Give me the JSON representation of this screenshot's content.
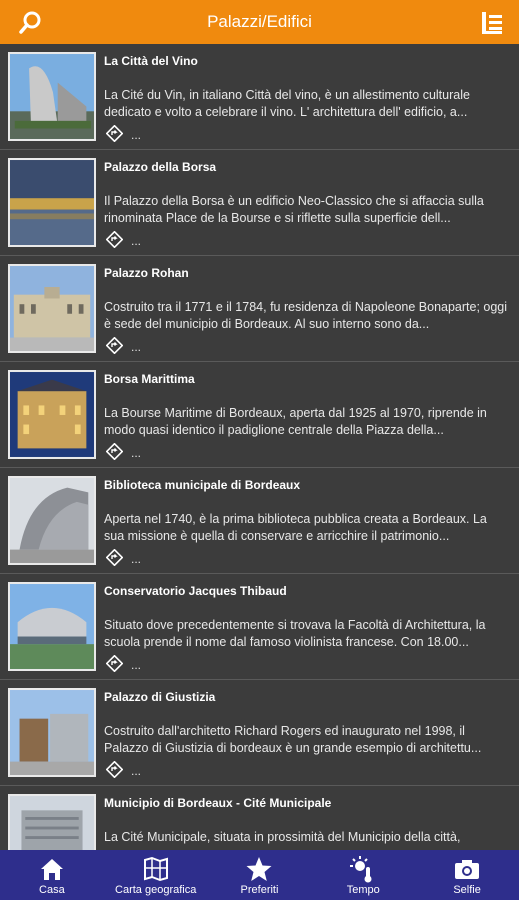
{
  "header": {
    "title": "Palazzi/Edifici",
    "search_icon": "search-icon",
    "menu_icon": "list-menu-icon"
  },
  "items": [
    {
      "title": "La Città del Vino",
      "desc": "La Cité du Vin, in italiano Città del vino, è un allestimento culturale dedicato e volto a celebrare il vino. L' architettura dell' edificio, a...",
      "more": "..."
    },
    {
      "title": "Palazzo della Borsa",
      "desc": "Il Palazzo della Borsa è un edificio Neo-Classico che si affaccia sulla rinominata Place de la Bourse e si riflette sulla superficie dell...",
      "more": "..."
    },
    {
      "title": "Palazzo Rohan",
      "desc": "Costruito tra il 1771 e il 1784, fu residenza di Napoleone Bonaparte; oggi è sede del municipio di Bordeaux. Al suo interno sono da...",
      "more": "..."
    },
    {
      "title": "Borsa Marittima",
      "desc": "La Bourse Maritime di Bordeaux, aperta dal 1925 al 1970, riprende in modo quasi identico il padiglione centrale della Piazza della...",
      "more": "..."
    },
    {
      "title": "Biblioteca municipale di Bordeaux",
      "desc": "Aperta nel 1740, è la prima biblioteca pubblica creata a Bordeaux. La sua missione è quella di conservare e arricchire il patrimonio...",
      "more": "..."
    },
    {
      "title": "Conservatorio Jacques Thibaud",
      "desc": "Situato dove precedentemente si trovava la Facoltà di Architettura, la scuola prende il nome dal famoso violinista francese. Con 18.00...",
      "more": "..."
    },
    {
      "title": "Palazzo di Giustizia",
      "desc": "Costruito dall'architetto Richard Rogers ed inaugurato nel 1998, il Palazzo di Giustizia di bordeaux è un grande esempio di architettu...",
      "more": "..."
    },
    {
      "title": "Municipio di Bordeaux - Cité Municipale",
      "desc": "La Cité Municipale, situata in prossimità del Municipio della città,",
      "more": "..."
    }
  ],
  "tabs": [
    {
      "label": "Casa",
      "icon": "home-icon"
    },
    {
      "label": "Carta geografica",
      "icon": "map-icon"
    },
    {
      "label": "Preferiti",
      "icon": "star-icon"
    },
    {
      "label": "Tempo",
      "icon": "weather-icon"
    },
    {
      "label": "Selfie",
      "icon": "camera-icon"
    }
  ],
  "colors": {
    "header": "#f08a0e",
    "bottombar": "#2e2e8c",
    "background": "#3c3c3c"
  }
}
